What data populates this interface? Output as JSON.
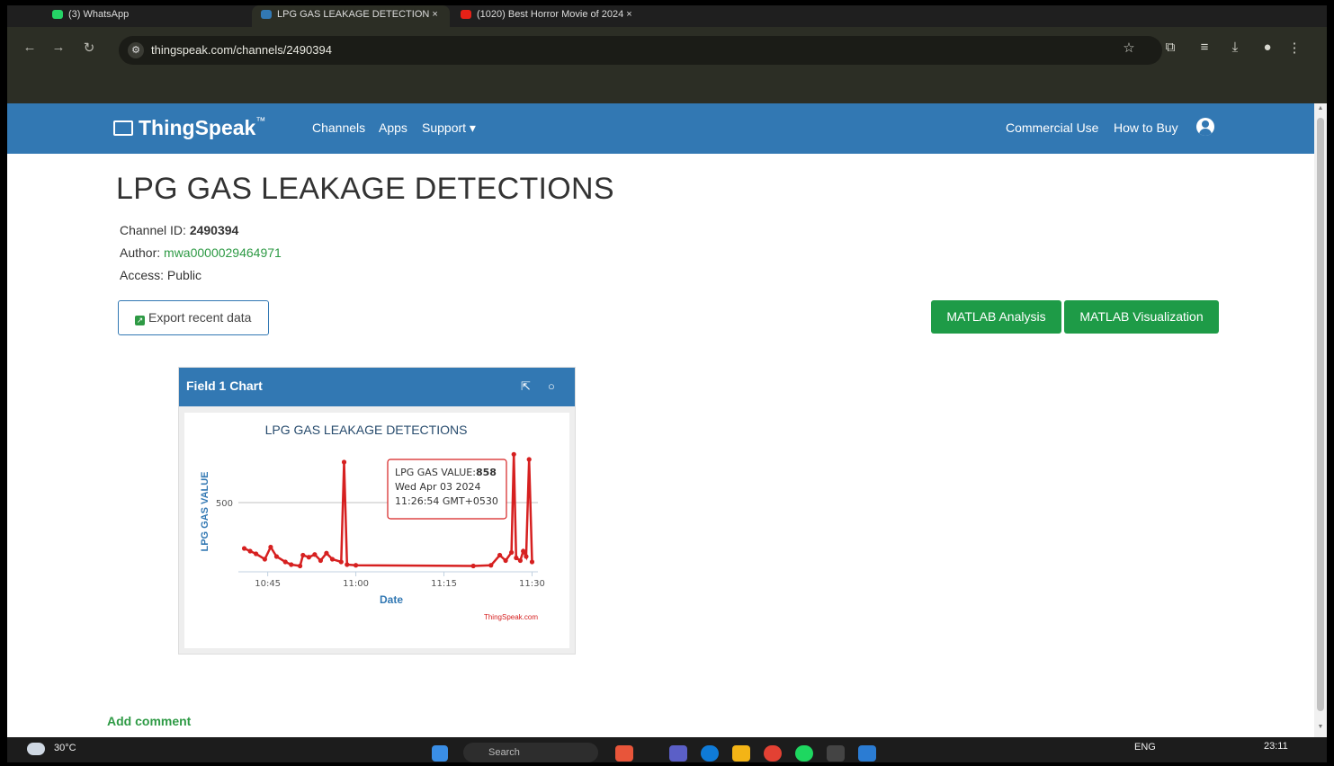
{
  "browser": {
    "tabs": [
      {
        "label": "(3) WhatsApp",
        "color": "#25d366"
      },
      {
        "label": "LPG GAS LEAKAGE DETECTION ×",
        "color": "#3278b3"
      },
      {
        "label": "(1020) Best Horror Movie of 2024 ×",
        "color": "#e62117"
      }
    ],
    "url": "thingspeak.com/channels/2490394"
  },
  "navbar": {
    "logo": "ThingSpeak",
    "logo_tm": "™",
    "links": [
      "Channels",
      "Apps",
      "Support ▾"
    ],
    "right_links": [
      "Commercial Use",
      "How to Buy"
    ]
  },
  "channel": {
    "title": "LPG GAS LEAKAGE DETECTIONS",
    "id_label": "Channel ID: ",
    "id": "2490394",
    "author_label": "Author: ",
    "author": "mwa0000029464971",
    "access": "Access: Public",
    "export_label": "Export recent data",
    "matlab_analysis": "MATLAB Analysis",
    "matlab_visualization": "MATLAB Visualization"
  },
  "widget": {
    "title": "Field 1 Chart"
  },
  "chart_data": {
    "type": "line",
    "title": "LPG GAS LEAKAGE DETECTIONS",
    "xlabel": "Date",
    "ylabel": "LPG GAS VALUE",
    "credit": "ThingSpeak.com",
    "x_ticks": [
      "10:45",
      "11:00",
      "11:15",
      "11:30"
    ],
    "y_ticks": [
      500
    ],
    "color": "#d62020",
    "series": [
      {
        "name": "LPG GAS VALUE",
        "points": [
          {
            "t": 41.0,
            "v": 160
          },
          {
            "t": 42.0,
            "v": 140
          },
          {
            "t": 43.0,
            "v": 120
          },
          {
            "t": 44.5,
            "v": 80
          },
          {
            "t": 45.5,
            "v": 170
          },
          {
            "t": 46.5,
            "v": 100
          },
          {
            "t": 48.0,
            "v": 60
          },
          {
            "t": 49.0,
            "v": 40
          },
          {
            "t": 50.5,
            "v": 30
          },
          {
            "t": 51.0,
            "v": 110
          },
          {
            "t": 52.0,
            "v": 95
          },
          {
            "t": 53.0,
            "v": 115
          },
          {
            "t": 54.0,
            "v": 70
          },
          {
            "t": 55.0,
            "v": 125
          },
          {
            "t": 56.0,
            "v": 80
          },
          {
            "t": 57.5,
            "v": 60
          },
          {
            "t": 58.0,
            "v": 800
          },
          {
            "t": 58.5,
            "v": 40
          },
          {
            "t": 60.0,
            "v": 35
          },
          {
            "t": 80.0,
            "v": 30
          },
          {
            "t": 83.0,
            "v": 35
          },
          {
            "t": 84.5,
            "v": 110
          },
          {
            "t": 85.5,
            "v": 70
          },
          {
            "t": 86.5,
            "v": 130
          },
          {
            "t": 86.9,
            "v": 858
          },
          {
            "t": 87.3,
            "v": 90
          },
          {
            "t": 88.0,
            "v": 70
          },
          {
            "t": 88.5,
            "v": 140
          },
          {
            "t": 89.0,
            "v": 100
          },
          {
            "t": 89.5,
            "v": 820
          },
          {
            "t": 90.0,
            "v": 60
          }
        ]
      }
    ],
    "tooltip": {
      "label": "LPG GAS VALUE:",
      "value": "858",
      "line2": "Wed Apr 03 2024",
      "line3": "11:26:54 GMT+0530"
    }
  },
  "add_comment": "Add comment",
  "taskbar": {
    "weather": "30°C",
    "search": "Search",
    "lang": "ENG",
    "time": "23:11"
  }
}
